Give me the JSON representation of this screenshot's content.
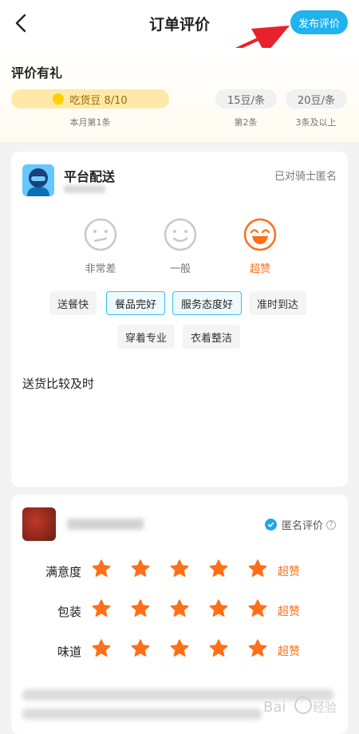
{
  "header": {
    "title": "订单评价",
    "publish_label": "发布评价"
  },
  "reward": {
    "title": "评价有礼",
    "tiers": [
      {
        "label": "吃货豆 8/10",
        "sub": "本月第1条"
      },
      {
        "label": "15豆/条",
        "sub": "第2条"
      },
      {
        "label": "20豆/条",
        "sub": "3条及以上"
      }
    ]
  },
  "rider": {
    "name": "平台配送",
    "anon_note": "已对骑士匿名",
    "faces": [
      {
        "label": "非常差",
        "selected": false
      },
      {
        "label": "一般",
        "selected": false
      },
      {
        "label": "超赞",
        "selected": true
      }
    ],
    "tags": [
      {
        "label": "送餐快",
        "selected": false
      },
      {
        "label": "餐品完好",
        "selected": true
      },
      {
        "label": "服务态度好",
        "selected": true
      },
      {
        "label": "准时到达",
        "selected": false
      },
      {
        "label": "穿着专业",
        "selected": false
      },
      {
        "label": "衣着整洁",
        "selected": false
      }
    ],
    "comment": "送货比较及时"
  },
  "dish": {
    "anon_label": "匿名评价",
    "help_icon": "?",
    "ratings": [
      {
        "label": "满意度",
        "stars": 5,
        "text": "超赞"
      },
      {
        "label": "包装",
        "stars": 5,
        "text": "超赞"
      },
      {
        "label": "味道",
        "stars": 5,
        "text": "超赞"
      }
    ]
  },
  "colors": {
    "accent": "#1fb3ef",
    "orange": "#ff6f18"
  }
}
